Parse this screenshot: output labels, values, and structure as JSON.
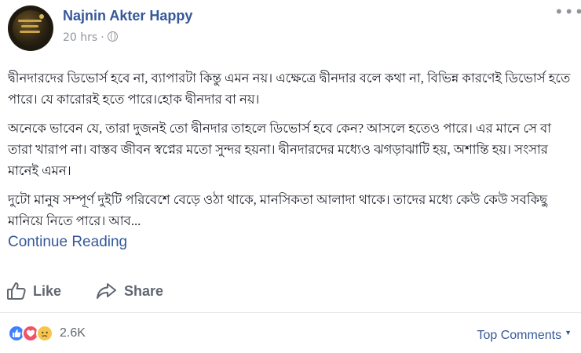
{
  "post": {
    "author": "Najnin Akter Happy",
    "time": "20 hrs",
    "separator": "·",
    "privacy_icon": "globe-icon",
    "more_icon": "more-options-icon",
    "paragraphs": [
      "দ্বীনদারদের ডিভোর্স হবে না, ব্যাপারটা কিন্তু এমন নয়। এক্ষেত্রে দ্বীনদার বলে কথা না, বিভিন্ন কারণেই ডিভোর্স হতে পারে। যে কারোরই হতে পারে।হোক দ্বীনদার বা নয়।",
      "অনেকে ভাবেন যে, তারা দুজনই তো দ্বীনদার তাহলে ডিভোর্স হবে কেন? আসলে হতেও পারে। এর মানে সে বা তারা খারাপ না। বাস্তব জীবন স্বপ্নের মতো সুন্দর হয়না। দ্বীনদারদের মধ্যেও ঝগড়াঝাটি হয়, অশান্তি হয়। সংসার মানেই এমন।",
      "দুটো মানুষ সম্পূর্ণ দুইটি পরিবেশে বেড়ে ওঠা থাকে, মানসিকতা আলাদা থাকে। তাদের মধ্যে কেউ কেউ সবকিছু মানিয়ে নিতে পারে। আব..."
    ],
    "continue_label": "Continue Reading"
  },
  "actions": {
    "like_label": "Like",
    "like_icon": "thumbs-up-icon",
    "share_label": "Share",
    "share_icon": "share-arrow-icon"
  },
  "footer": {
    "reactions": [
      "like",
      "love",
      "sad"
    ],
    "reaction_count": "2.6K",
    "sort_label": "Top Comments",
    "sort_caret": "▼"
  },
  "colors": {
    "link": "#365899",
    "meta": "#90949c",
    "action": "#606770",
    "like_reaction": "#4080ff",
    "love_reaction": "#f25268",
    "sad_reaction": "#f7c54b"
  }
}
